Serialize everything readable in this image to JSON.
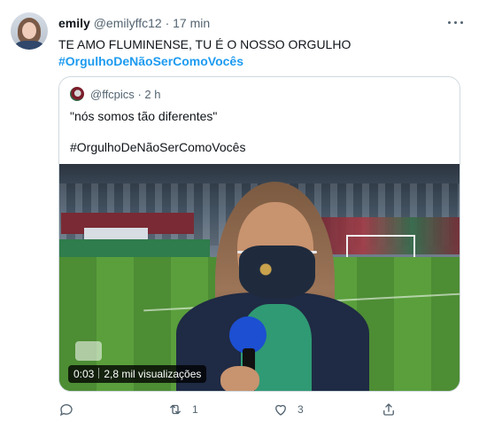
{
  "tweet": {
    "author": {
      "name": "emily",
      "handle": "@emilyffc12",
      "separator": "·",
      "time": "17 min"
    },
    "text": "TE AMO FLUMINENSE, TU É O NOSSO ORGULHO",
    "hashtag": "#OrgulhoDeNãoSerComoVocês",
    "quote": {
      "handle": "@ffcpics",
      "separator": "·",
      "time": "2 h",
      "line1": "\"nós somos tão diferentes\"",
      "line2": "#OrgulhoDeNãoSerComoVocês",
      "video": {
        "duration": "0:03",
        "views": "2,8 mil visualizações"
      }
    },
    "actions": {
      "reply": {
        "icon": "reply-icon",
        "count": ""
      },
      "retweet": {
        "icon": "retweet-icon",
        "count": "1"
      },
      "like": {
        "icon": "heart-icon",
        "count": "3"
      },
      "share": {
        "icon": "share-icon",
        "count": ""
      }
    }
  },
  "colors": {
    "link": "#1d9bf0",
    "secondary_text": "#536471",
    "border": "#cfd9de"
  }
}
